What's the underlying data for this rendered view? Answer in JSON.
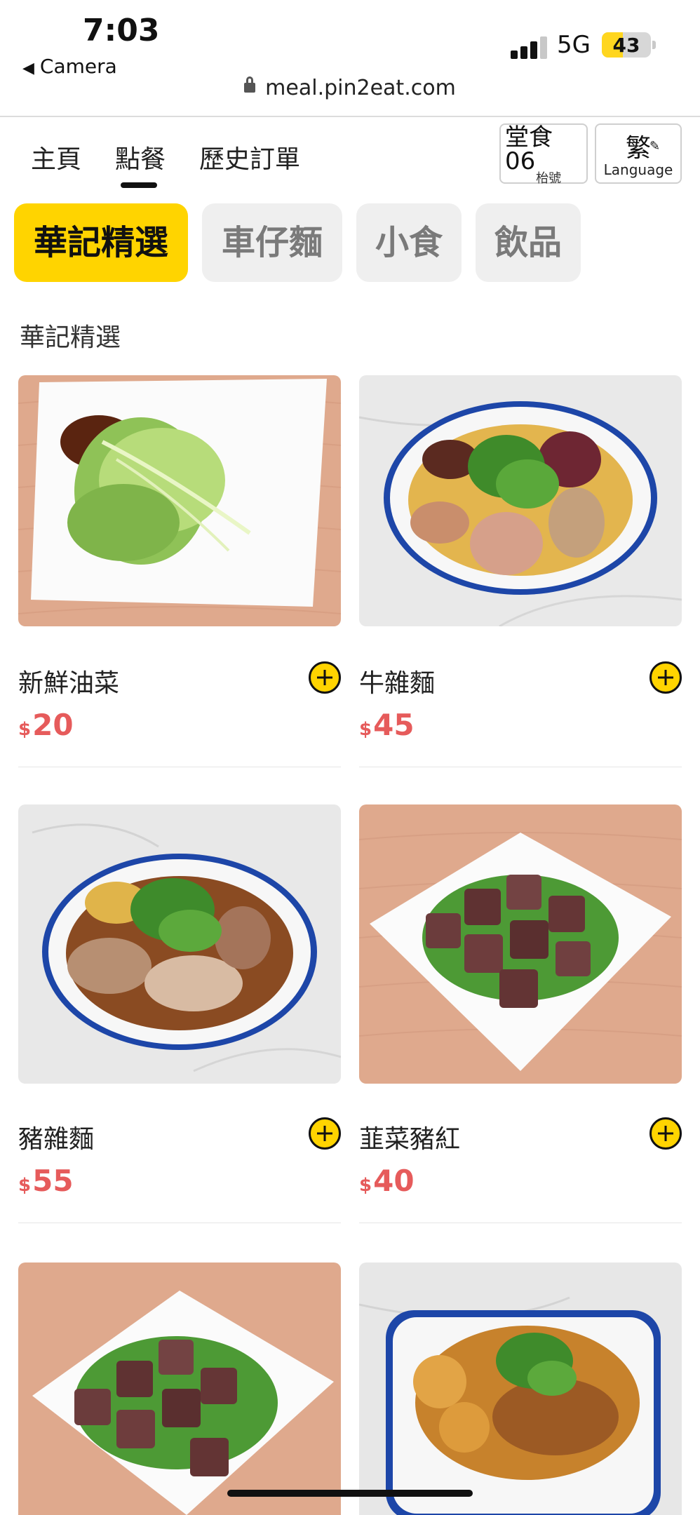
{
  "status_bar": {
    "time": "7:03",
    "back_label": "Camera",
    "network": "5G",
    "battery": "43",
    "battery_level_percent": 43,
    "url": "meal.pin2eat.com"
  },
  "nav": {
    "tabs": [
      "主頁",
      "點餐",
      "歷史訂單"
    ],
    "active_tab": "點餐",
    "seat": {
      "mode": "堂食",
      "number": "06",
      "label": "枱號"
    },
    "language": {
      "current": "繁",
      "label": "Language",
      "icon": "pencil-icon"
    }
  },
  "categories": [
    "華記精選",
    "車仔麵",
    "小食",
    "飲品"
  ],
  "active_category": "華記精選",
  "section_title": "華記精選",
  "products": [
    {
      "name": "新鮮油菜",
      "currency": "$",
      "price": "20"
    },
    {
      "name": "牛雜麵",
      "currency": "$",
      "price": "45"
    },
    {
      "name": "豬雜麵",
      "currency": "$",
      "price": "55"
    },
    {
      "name": "韮菜豬紅",
      "currency": "$",
      "price": "40"
    }
  ],
  "colors": {
    "accent": "#ffd400",
    "price": "#e65b5b",
    "chip_inactive": "#efefef"
  }
}
